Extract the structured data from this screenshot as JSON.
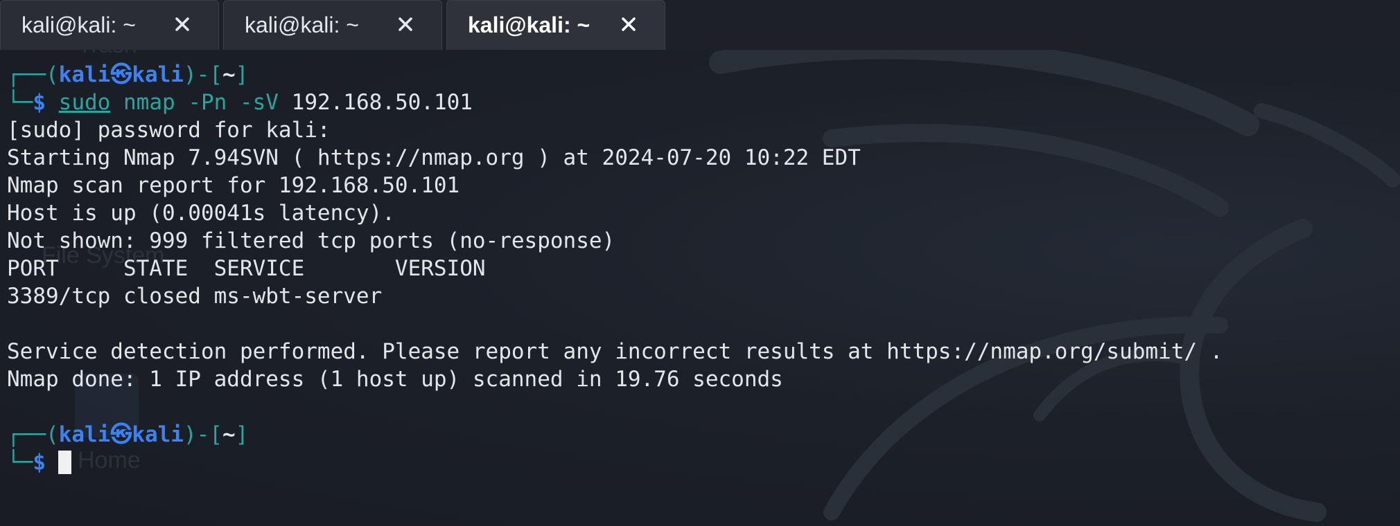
{
  "tabs": [
    {
      "label": "kali@kali: ~",
      "active": false
    },
    {
      "label": "kali@kali: ~",
      "active": false
    },
    {
      "label": "kali@kali: ~",
      "active": true
    }
  ],
  "tab_close_symbol": "×",
  "prompt": {
    "open": "┌──(",
    "user": "kali",
    "skull": "㉿",
    "host": "kali",
    "close_mid": ")-[",
    "dir": "~",
    "close_end": "]",
    "second_line_prefix": "└─",
    "symbol": "$"
  },
  "command": {
    "sudo": "sudo",
    "program": "nmap",
    "args": "-Pn -sV",
    "target": "192.168.50.101"
  },
  "output": [
    "[sudo] password for kali:",
    "Starting Nmap 7.94SVN ( https://nmap.org ) at 2024-07-20 10:22 EDT",
    "Nmap scan report for 192.168.50.101",
    "Host is up (0.00041s latency).",
    "Not shown: 999 filtered tcp ports (no-response)",
    "PORT     STATE  SERVICE       VERSION",
    "3389/tcp closed ms-wbt-server",
    "",
    "Service detection performed. Please report any incorrect results at https://nmap.org/submit/ .",
    "Nmap done: 1 IP address (1 host up) scanned in 19.76 seconds"
  ],
  "desktop_ghosts": {
    "trash": "Trash",
    "filesystem": "File System",
    "home": "Home"
  },
  "colors": {
    "background": "#1b1f27",
    "prompt_box": "#2aa6a0",
    "prompt_user": "#3b82f6",
    "text": "#e4e6ea"
  }
}
